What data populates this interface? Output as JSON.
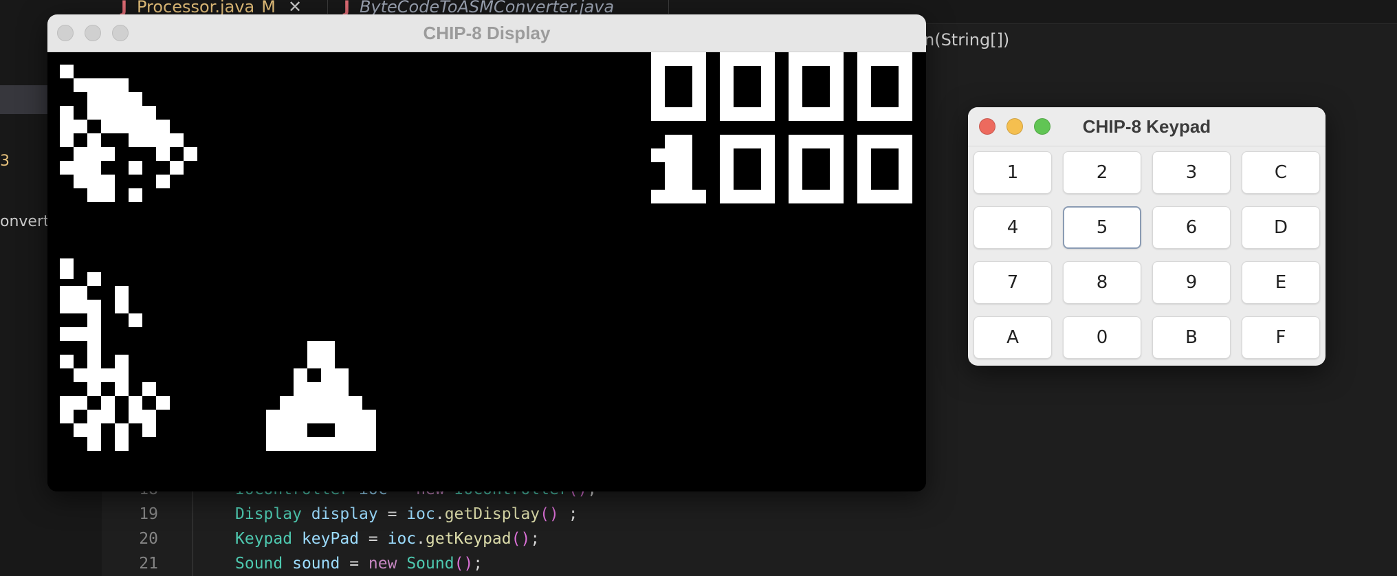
{
  "editor": {
    "tabs": [
      {
        "icon": "J",
        "label": "Processor.java",
        "badge": "M",
        "close": "✕"
      },
      {
        "icon": "J",
        "label": "ByteCodeToASMConverter.java"
      }
    ],
    "sidebar_fragments": [
      "3",
      "onverte"
    ],
    "breadcrumb_fragment": "n(String[])",
    "lines": [
      {
        "num": "18",
        "tokens": [
          {
            "k": "t-type",
            "t": "IOController"
          },
          {
            "k": "t-plain",
            "t": " "
          },
          {
            "k": "t-var",
            "t": "ioc"
          },
          {
            "k": "t-plain",
            "t": " = "
          },
          {
            "k": "t-kw",
            "t": "new"
          },
          {
            "k": "t-plain",
            "t": " "
          },
          {
            "k": "t-type",
            "t": "IOController"
          },
          {
            "k": "t-paren",
            "t": "()"
          },
          {
            "k": "t-plain",
            "t": ";"
          }
        ]
      },
      {
        "num": "19",
        "tokens": [
          {
            "k": "t-type",
            "t": "Display"
          },
          {
            "k": "t-plain",
            "t": " "
          },
          {
            "k": "t-var",
            "t": "display"
          },
          {
            "k": "t-plain",
            "t": " = "
          },
          {
            "k": "t-var",
            "t": "ioc"
          },
          {
            "k": "t-plain",
            "t": "."
          },
          {
            "k": "t-fn",
            "t": "getDisplay"
          },
          {
            "k": "t-paren",
            "t": "()"
          },
          {
            "k": "t-plain",
            "t": " ;"
          }
        ]
      },
      {
        "num": "20",
        "tokens": [
          {
            "k": "t-type",
            "t": "Keypad"
          },
          {
            "k": "t-plain",
            "t": " "
          },
          {
            "k": "t-var",
            "t": "keyPad"
          },
          {
            "k": "t-plain",
            "t": " = "
          },
          {
            "k": "t-var",
            "t": "ioc"
          },
          {
            "k": "t-plain",
            "t": "."
          },
          {
            "k": "t-fn",
            "t": "getKeypad"
          },
          {
            "k": "t-paren",
            "t": "()"
          },
          {
            "k": "t-plain",
            "t": ";"
          }
        ]
      },
      {
        "num": "21",
        "tokens": [
          {
            "k": "t-type",
            "t": "Sound"
          },
          {
            "k": "t-plain",
            "t": " "
          },
          {
            "k": "t-var",
            "t": "sound"
          },
          {
            "k": "t-plain",
            "t": " = "
          },
          {
            "k": "t-kw",
            "t": "new"
          },
          {
            "k": "t-plain",
            "t": " "
          },
          {
            "k": "t-type",
            "t": "Sound"
          },
          {
            "k": "t-paren",
            "t": "()"
          },
          {
            "k": "t-plain",
            "t": ";"
          }
        ]
      }
    ]
  },
  "display_window": {
    "title": "CHIP-8 Display",
    "traffic_lights": [
      "close-button",
      "minimize-button",
      "zoom-button"
    ],
    "colors": {
      "on": "#ffffff",
      "off": "#000000"
    },
    "score_rows": [
      "0000",
      "1000"
    ]
  },
  "keypad_window": {
    "title": "CHIP-8 Keypad",
    "traffic_lights": [
      {
        "name": "close-button",
        "color": "#ed6a5e"
      },
      {
        "name": "minimize-button",
        "color": "#f5bf4f"
      },
      {
        "name": "zoom-button",
        "color": "#61c554"
      }
    ],
    "focused_key": "5",
    "keys": [
      "1",
      "2",
      "3",
      "C",
      "4",
      "5",
      "6",
      "D",
      "7",
      "8",
      "9",
      "E",
      "A",
      "0",
      "B",
      "F"
    ]
  }
}
